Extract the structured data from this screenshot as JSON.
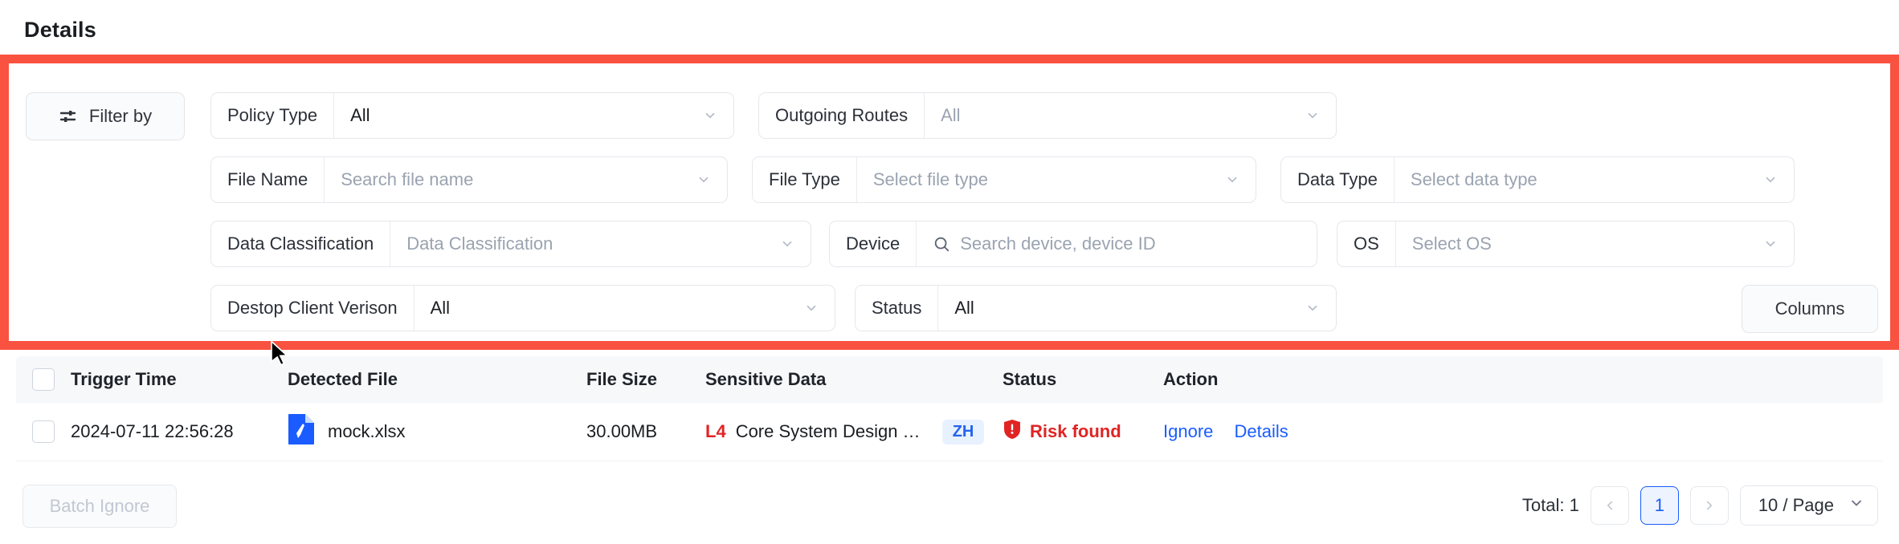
{
  "page": {
    "title": "Details"
  },
  "filters": {
    "filter_by_label": "Filter by",
    "filter_by_icon": "sliders-icon",
    "columns_label": "Columns",
    "rows": [
      [
        {
          "label": "Policy Type",
          "value": "All",
          "placeholder": false,
          "icon": "chevron-down-icon"
        },
        {
          "label": "Outgoing Routes",
          "value": "All",
          "placeholder": true,
          "icon": "chevron-down-icon"
        }
      ],
      [
        {
          "label": "File Name",
          "value": "Search file name",
          "placeholder": true,
          "icon": "chevron-down-icon"
        },
        {
          "label": "File Type",
          "value": "Select file type",
          "placeholder": true,
          "icon": "chevron-down-icon"
        },
        {
          "label": "Data Type",
          "value": "Select data type",
          "placeholder": true,
          "icon": "chevron-down-icon"
        }
      ],
      [
        {
          "label": "Data Classification",
          "value": "Data Classification",
          "placeholder": true,
          "icon": "chevron-down-icon"
        },
        {
          "label": "Device",
          "value": "Search device, device ID",
          "placeholder": true,
          "icon": "search-icon"
        },
        {
          "label": "OS",
          "value": "Select OS",
          "placeholder": true,
          "icon": "chevron-down-icon"
        }
      ],
      [
        {
          "label": "Destop Client Verison",
          "value": "All",
          "placeholder": false,
          "icon": "chevron-down-icon"
        },
        {
          "label": "Status",
          "value": "All",
          "placeholder": false,
          "icon": "chevron-down-icon"
        }
      ]
    ]
  },
  "table": {
    "columns": [
      "Trigger Time",
      "Detected File",
      "File Size",
      "Sensitive Data",
      "Status",
      "Action"
    ],
    "rows": [
      {
        "trigger_time": "2024-07-11 22:56:28",
        "detected_file": "mock.xlsx",
        "file_icon": "document-pen-icon",
        "file_size": "30.00MB",
        "sensitive_level": "L4",
        "sensitive_data": "Core System Design Document…",
        "language_badge": "ZH",
        "status": "Risk found",
        "status_icon": "shield-alert-icon",
        "actions": [
          "Ignore",
          "Details"
        ]
      }
    ]
  },
  "footer": {
    "batch_ignore_label": "Batch Ignore",
    "total_label": "Total: 1",
    "prev_icon": "chevron-left-icon",
    "next_icon": "chevron-right-icon",
    "current_page": "1",
    "page_size": "10  / Page",
    "page_size_icon": "chevron-down-icon"
  },
  "colors": {
    "annotation_border": "#fa5240",
    "link": "#1a5cff",
    "danger": "#e02424",
    "badge_text": "#2563eb",
    "badge_bg": "#e8f1ff"
  }
}
